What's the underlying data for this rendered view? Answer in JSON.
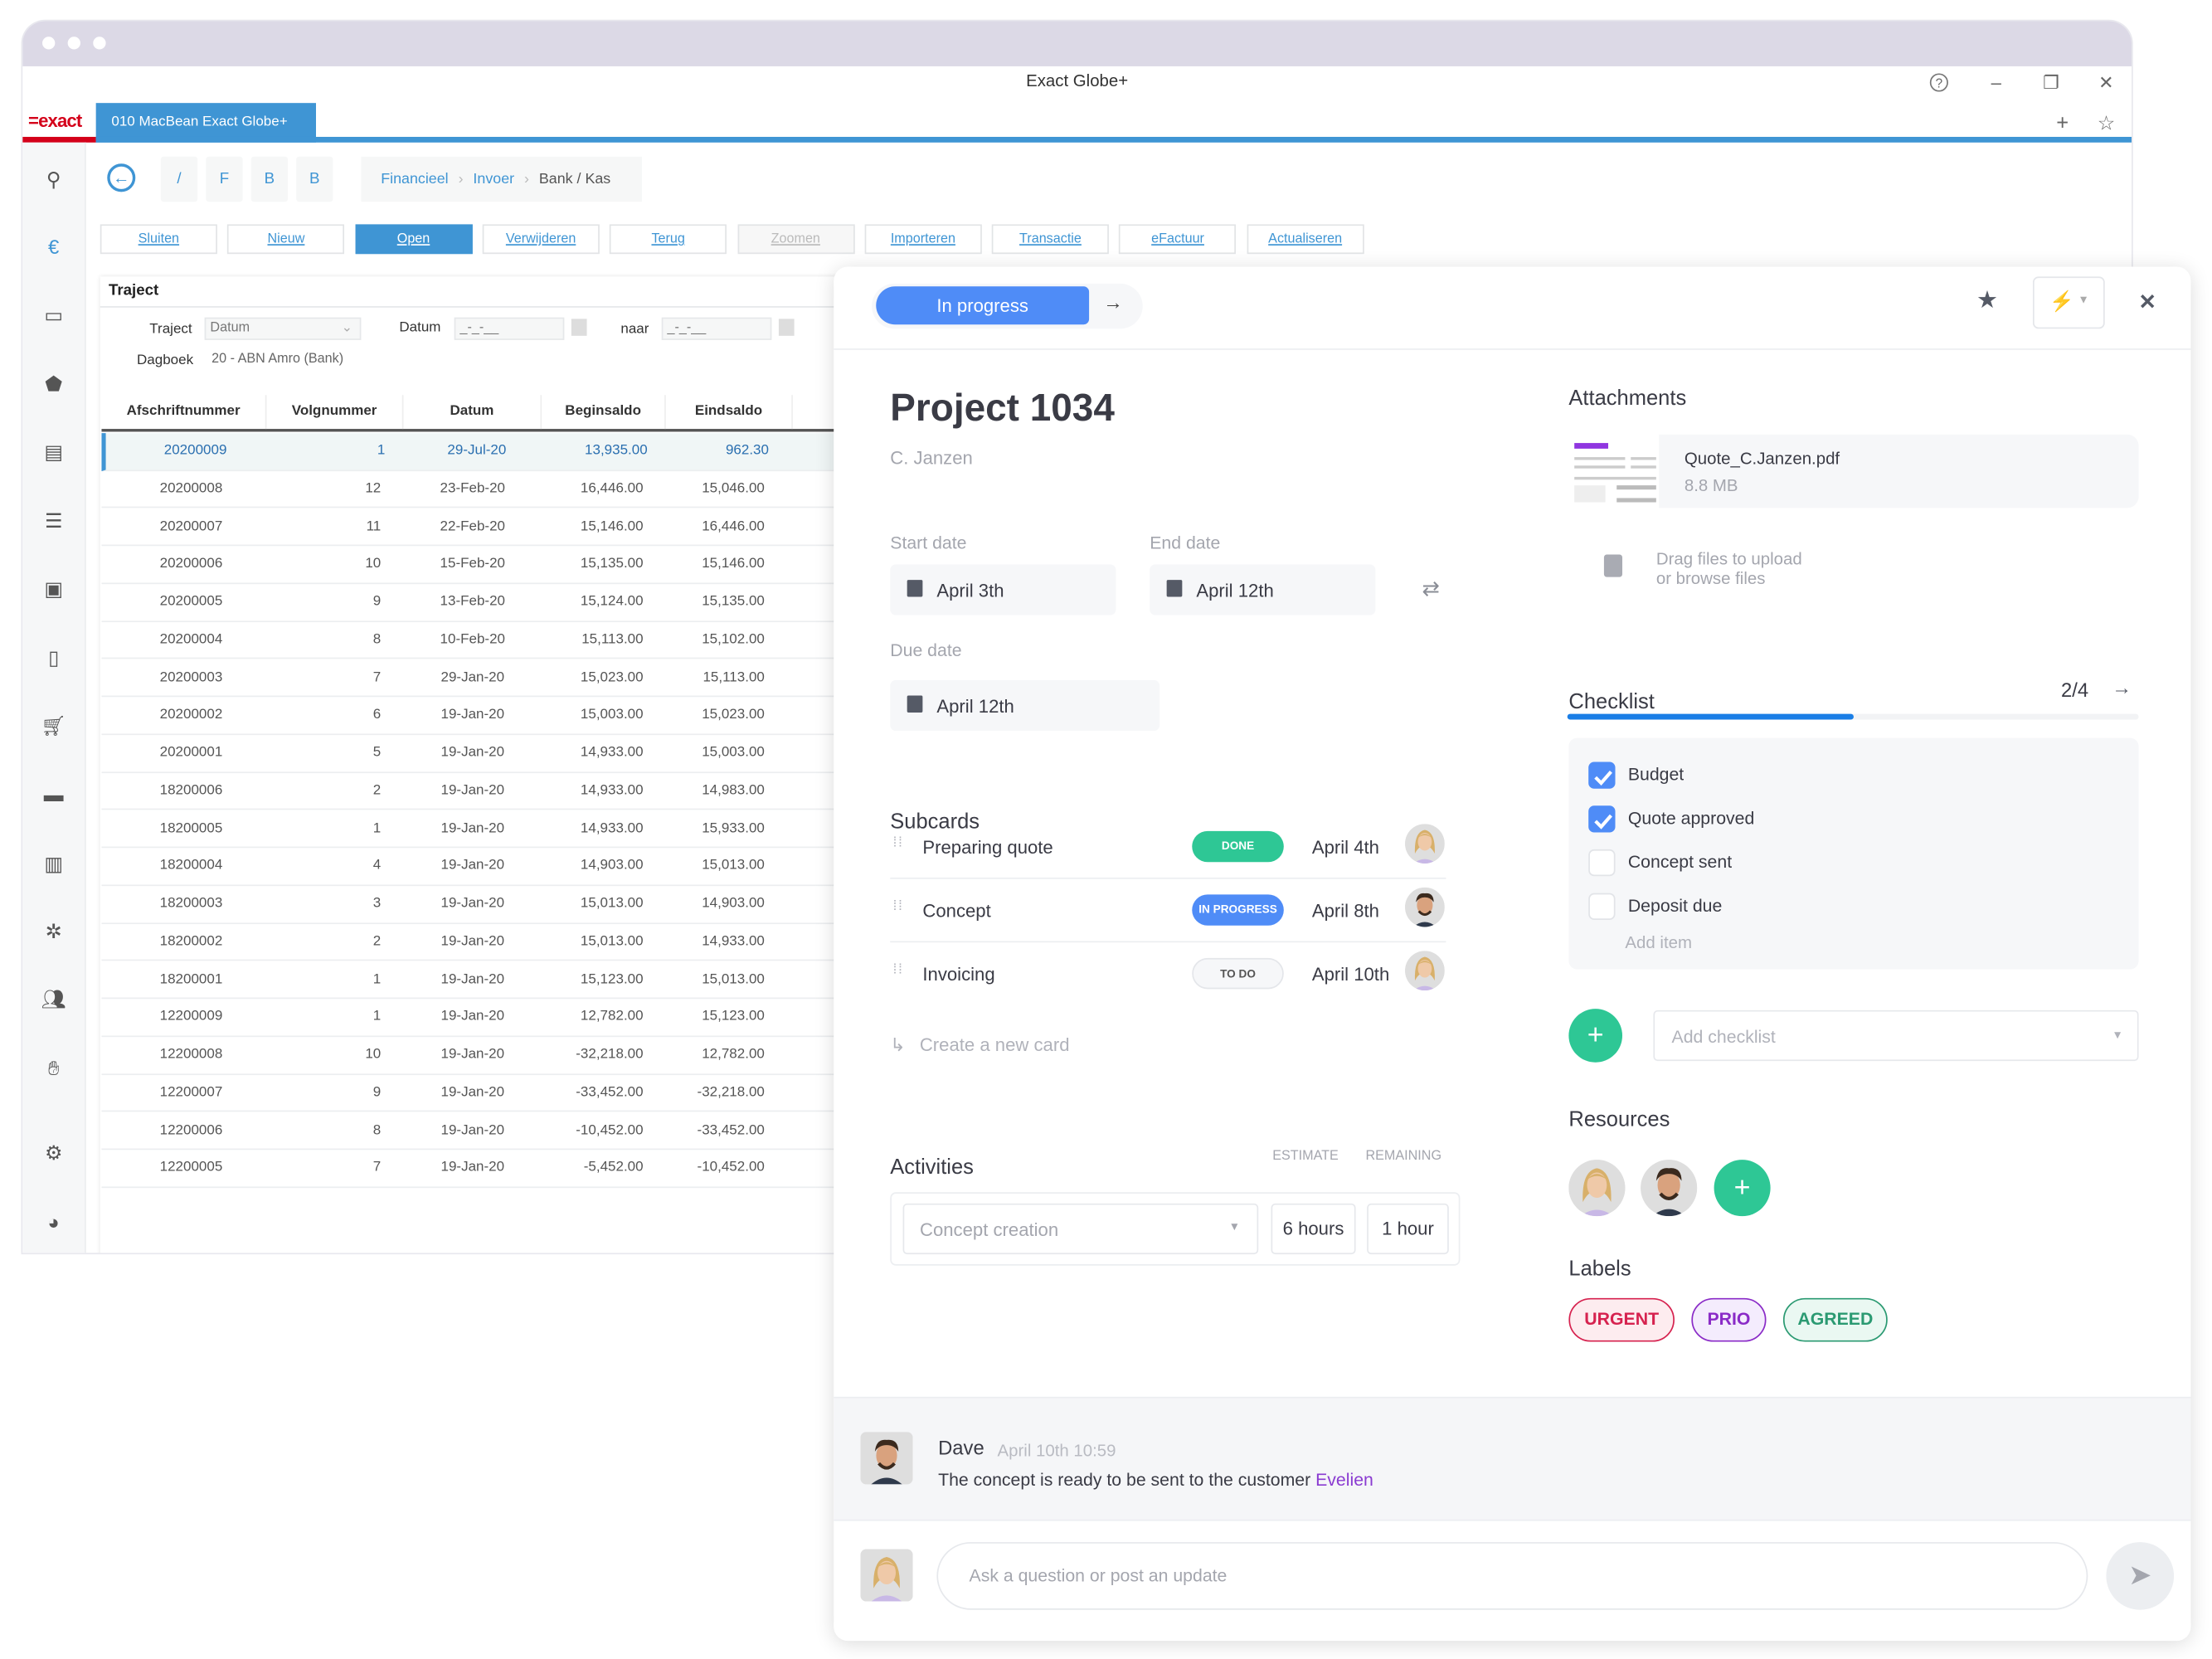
{
  "window": {
    "title": "Exact Globe+",
    "logo": "=exact",
    "tab": "010  MacBean Exact Globe+"
  },
  "nav": {
    "quick_buttons": [
      "/",
      "F",
      "B",
      "B"
    ],
    "breadcrumb": [
      "Financieel",
      "Invoer",
      "Bank / Kas"
    ]
  },
  "toolbar": {
    "buttons": [
      {
        "label": "Sluiten",
        "state": "normal"
      },
      {
        "label": "Nieuw",
        "state": "normal"
      },
      {
        "label": "Open",
        "state": "active"
      },
      {
        "label": "Verwijderen",
        "state": "normal"
      },
      {
        "label": "Terug",
        "state": "normal"
      },
      {
        "label": "Zoomen",
        "state": "disabled"
      },
      {
        "label": "Importeren",
        "state": "normal"
      },
      {
        "label": "Transactie",
        "state": "normal"
      },
      {
        "label": "eFactuur",
        "state": "normal"
      },
      {
        "label": "Actualiseren",
        "state": "normal"
      }
    ]
  },
  "sidebar": {
    "icons": [
      "search-icon",
      "euro-icon",
      "monitor-icon",
      "box-icon",
      "ledger-icon",
      "list-icon",
      "building-icon",
      "phone-icon",
      "cart-icon",
      "wallet-icon",
      "factory-icon",
      "bug-icon",
      "users-icon",
      "handshake-icon",
      "gear-icon",
      "pie-chart-icon"
    ]
  },
  "traject": {
    "title": "Traject",
    "traject_label": "Traject",
    "traject_value": "Datum",
    "datum_label": "Datum",
    "datum_value": "_-_-__",
    "naar_label": "naar",
    "naar_value": "_-_-__",
    "dagboek_label": "Dagboek",
    "dagboek_value": "20 - ABN Amro (Bank)"
  },
  "table": {
    "columns": [
      "Afschriftnummer",
      "Volgnummer",
      "Datum",
      "Beginsaldo",
      "Eindsaldo"
    ],
    "rows": [
      [
        "20200009",
        "1",
        "29-Jul-20",
        "13,935.00",
        "962.30"
      ],
      [
        "20200008",
        "12",
        "23-Feb-20",
        "16,446.00",
        "15,046.00"
      ],
      [
        "20200007",
        "11",
        "22-Feb-20",
        "15,146.00",
        "16,446.00"
      ],
      [
        "20200006",
        "10",
        "15-Feb-20",
        "15,135.00",
        "15,146.00"
      ],
      [
        "20200005",
        "9",
        "13-Feb-20",
        "15,124.00",
        "15,135.00"
      ],
      [
        "20200004",
        "8",
        "10-Feb-20",
        "15,113.00",
        "15,102.00"
      ],
      [
        "20200003",
        "7",
        "29-Jan-20",
        "15,023.00",
        "15,113.00"
      ],
      [
        "20200002",
        "6",
        "19-Jan-20",
        "15,003.00",
        "15,023.00"
      ],
      [
        "20200001",
        "5",
        "19-Jan-20",
        "14,933.00",
        "15,003.00"
      ],
      [
        "18200006",
        "2",
        "19-Jan-20",
        "14,933.00",
        "14,983.00"
      ],
      [
        "18200005",
        "1",
        "19-Jan-20",
        "14,933.00",
        "15,933.00"
      ],
      [
        "18200004",
        "4",
        "19-Jan-20",
        "14,903.00",
        "15,013.00"
      ],
      [
        "18200003",
        "3",
        "19-Jan-20",
        "15,013.00",
        "14,903.00"
      ],
      [
        "18200002",
        "2",
        "19-Jan-20",
        "15,013.00",
        "14,933.00"
      ],
      [
        "18200001",
        "1",
        "19-Jan-20",
        "15,123.00",
        "15,013.00"
      ],
      [
        "12200009",
        "1",
        "19-Jan-20",
        "12,782.00",
        "15,123.00"
      ],
      [
        "12200008",
        "10",
        "19-Jan-20",
        "-32,218.00",
        "12,782.00"
      ],
      [
        "12200007",
        "9",
        "19-Jan-20",
        "-33,452.00",
        "-32,218.00"
      ],
      [
        "12200006",
        "8",
        "19-Jan-20",
        "-10,452.00",
        "-33,452.00"
      ],
      [
        "12200005",
        "7",
        "19-Jan-20",
        "-5,452.00",
        "-10,452.00"
      ]
    ]
  },
  "card": {
    "status": "In progress",
    "status_color": "#4f8cf7",
    "title": "Project 1034",
    "client": "C. Janzen",
    "start_label": "Start date",
    "start": "April 3th",
    "end_label": "End date",
    "end": "April 12th",
    "due_label": "Due date",
    "due": "April 12th",
    "subcards_title": "Subcards",
    "subcards": [
      {
        "name": "Preparing quote",
        "status": "DONE",
        "date": "April 4th",
        "assignee": "woman"
      },
      {
        "name": "Concept",
        "status": "IN PROGRESS",
        "date": "April 8th",
        "assignee": "man"
      },
      {
        "name": "Invoicing",
        "status": "TO DO",
        "date": "April 10th",
        "assignee": "woman"
      }
    ],
    "create_card": "Create a new card",
    "activities_title": "Activities",
    "estimate_label": "ESTIMATE",
    "remaining_label": "REMAINING",
    "activity": "Concept creation",
    "estimate": "6 hours",
    "remaining": "1 hour",
    "attachments_title": "Attachments",
    "file_name": "Quote_C.Janzen.pdf",
    "file_size": "8.8 MB",
    "drag_line1": "Drag files to upload",
    "drag_line2": "or browse files",
    "checklist_title": "Checklist",
    "checklist_count": "2/4",
    "checklist_progress": 0.5,
    "checklist": [
      {
        "label": "Budget",
        "checked": true
      },
      {
        "label": "Quote approved",
        "checked": true
      },
      {
        "label": "Concept sent",
        "checked": false
      },
      {
        "label": "Deposit due",
        "checked": false
      }
    ],
    "add_item": "Add item",
    "add_checklist_placeholder": "Add checklist",
    "resources_title": "Resources",
    "labels_title": "Labels",
    "labels": [
      {
        "text": "URGENT",
        "color": "#d6224f"
      },
      {
        "text": "PRIO",
        "color": "#8a2bc7"
      },
      {
        "text": "AGREED",
        "color": "#2b9a72"
      }
    ],
    "comment": {
      "author": "Dave",
      "time": "April 10th 10:59",
      "text": "The concept is ready to be sent to the customer ",
      "mention": "Evelien"
    },
    "reply_placeholder": "Ask a question or post an update"
  }
}
